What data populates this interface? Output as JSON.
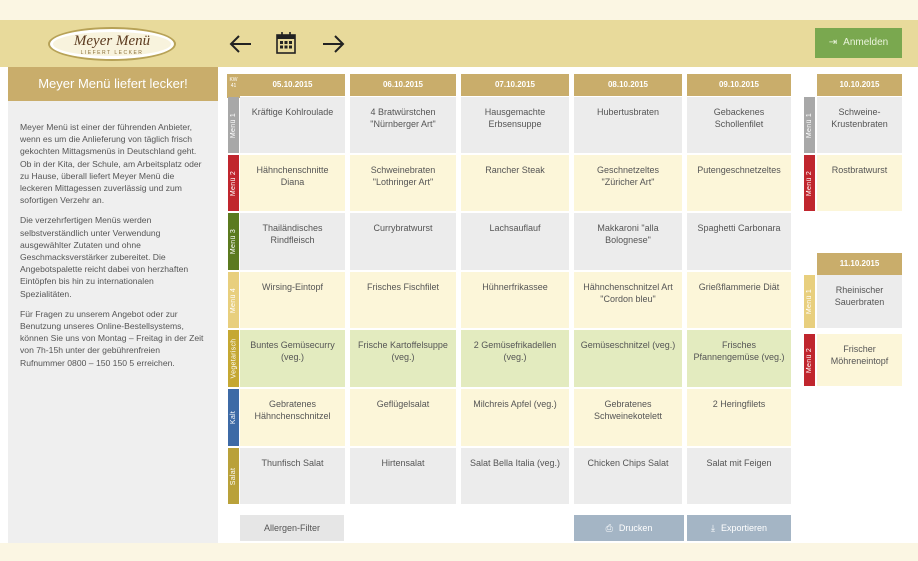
{
  "logo": {
    "name": "Meyer Menü",
    "tagline": "LIEFERT LECKER"
  },
  "nav": {
    "prev_label": "←",
    "next_label": "→"
  },
  "login": {
    "icon": "login-icon",
    "label": "Anmelden"
  },
  "sidebar": {
    "title": "Meyer Menü liefert lecker!",
    "paragraphs": [
      "Meyer Menü ist einer der führenden Anbieter, wenn es um die Anlieferung von täglich frisch gekochten Mittagsmenüs in Deutschland geht. Ob in der Kita, der Schule, am Arbeitsplatz oder zu Hause, überall liefert Meyer Menü die leckeren Mittagessen zuverlässig und zum sofortigen Verzehr an.",
      "Die verzehrfertigen Menüs werden selbstverständlich unter Verwendung ausgewählter Zutaten und ohne Geschmacksverstärker zubereitet. Die Angebotspalette reicht dabei von herzhaften Eintöpfen bis hin zu internationalen Spezialitäten.",
      "Für Fragen zu unserem Angebot oder zur Benutzung unseres Online-Bestellsystems, können Sie uns von Montag – Freitag in der Zeit von 7h-15h unter der gebührenfreien Rufnummer 0800 – 150 150 5 erreichen."
    ]
  },
  "week": {
    "kw_label": "KW",
    "kw_number": "41"
  },
  "dates": [
    "05.10.2015",
    "06.10.2015",
    "07.10.2015",
    "08.10.2015",
    "09.10.2015"
  ],
  "rows": [
    {
      "label": "Menü 1",
      "color": "#a8a8a8",
      "items": [
        "Kräftige Kohlroulade",
        "4 Bratwürstchen \"Nürnberger Art\"",
        "Hausgemachte Erbsensuppe",
        "Hubertusbraten",
        "Gebackenes Schollenfilet"
      ]
    },
    {
      "label": "Menü 2",
      "color": "#c0262e",
      "items": [
        "Hähnchenschnitte Diana",
        "Schweinebraten \"Lothringer Art\"",
        "Rancher Steak",
        "Geschnetzeltes \"Züricher Art\"",
        "Putengeschnetzeltes"
      ]
    },
    {
      "label": "Menü 3",
      "color": "#5b7a1f",
      "items": [
        "Thailändisches Rindfleisch",
        "Currybratwurst",
        "Lachsauflauf",
        "Makkaroni \"alla Bolognese\"",
        "Spaghetti Carbonara"
      ]
    },
    {
      "label": "Menü 4",
      "color": "#e8cf7e",
      "items": [
        "Wirsing-Eintopf",
        "Frisches Fischfilet",
        "Hühnerfrikassee",
        "Hähnchenschnitzel Art \"Cordon bleu\"",
        "Grießflammerie Diät"
      ]
    },
    {
      "label": "Vegetarisch",
      "color": "#c5a833",
      "items": [
        "Buntes Gemüsecurry (veg.)",
        "Frische Kartoffelsuppe (veg.)",
        "2 Gemüsefrikadellen (veg.)",
        "Gemüseschnitzel (veg.)",
        "Frisches Pfannengemüse (veg.)"
      ]
    },
    {
      "label": "Kalt",
      "color": "#3d6aa6",
      "items": [
        "Gebratenes Hähnchenschnitzel",
        "Geflügelsalat",
        "Milchreis Apfel (veg.)",
        "Gebratenes Schweinekotelett",
        "2 Heringfilets"
      ]
    },
    {
      "label": "Salat",
      "color": "#b9a13a",
      "items": [
        "Thunfisch Salat",
        "Hirtensalat",
        "Salat Bella Italia (veg.)",
        "Chicken Chips Salat",
        "Salat mit Feigen"
      ]
    }
  ],
  "weekend": [
    {
      "date": "10.10.2015",
      "rows": [
        {
          "label": "Menü 1",
          "color": "#a8a8a8",
          "item": "Schweine-Krustenbraten"
        },
        {
          "label": "Menü 2",
          "color": "#c0262e",
          "item": "Rostbratwurst"
        }
      ]
    },
    {
      "date": "11.10.2015",
      "rows": [
        {
          "label": "Menü 1",
          "color": "#e8cf7e",
          "item": "Rheinischer Sauerbraten"
        },
        {
          "label": "Menü 2",
          "color": "#c0262e",
          "item": "Frischer Möhreneintopf"
        }
      ]
    }
  ],
  "buttons": {
    "allergen": "Allergen-Filter",
    "print": {
      "icon": "printer-icon",
      "label": "Drucken"
    },
    "export": {
      "icon": "download-icon",
      "label": "Exportieren"
    }
  },
  "colors": {
    "header": "#e8da9b",
    "gold": "#c9ad6b",
    "green": "#7aa84f",
    "blue_button": "#a4b5c5"
  }
}
